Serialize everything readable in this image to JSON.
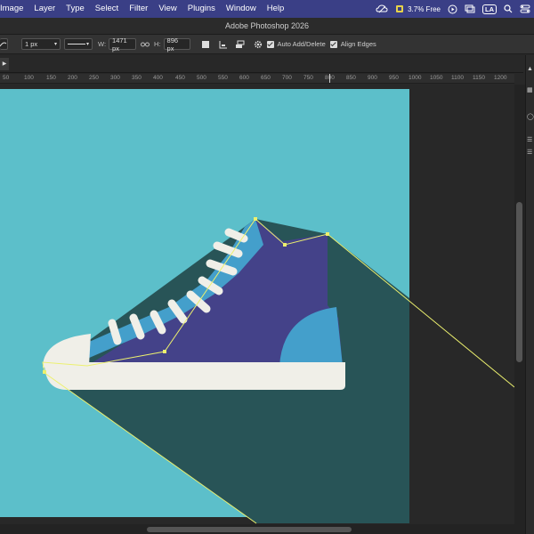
{
  "menubar": {
    "menus": [
      "Image",
      "Layer",
      "Type",
      "Select",
      "Filter",
      "View",
      "Plugins",
      "Window",
      "Help"
    ],
    "cpu_text": "3.7% Free",
    "la_badge": "LA"
  },
  "window": {
    "title": "Adobe Photoshop 2026"
  },
  "options": {
    "stroke_width": "1 px",
    "w_label": "W:",
    "w_value": "1471 px",
    "h_label": "H:",
    "h_value": "896 px",
    "auto_add_delete": "Auto Add/Delete",
    "align_edges": "Align Edges"
  },
  "ruler": {
    "labels": [
      "50",
      "100",
      "150",
      "200",
      "250",
      "300",
      "350",
      "400",
      "450",
      "500",
      "550",
      "600",
      "650",
      "700",
      "750",
      "800",
      "850",
      "900",
      "950",
      "1000",
      "1050",
      "1100",
      "1150",
      "1200"
    ]
  },
  "colors": {
    "background": "#5cbfca",
    "shadow": "#285457",
    "shoe_body": "#444289",
    "shoe_accent": "#449fcb",
    "sole": "#f0efe8",
    "path": "#ecf06e",
    "menubar": "#3a3f86"
  },
  "icons": {
    "cursor": "cursor-icon",
    "tool": "stroke-icon",
    "link": "link-icon",
    "gear": "gear-icon"
  }
}
